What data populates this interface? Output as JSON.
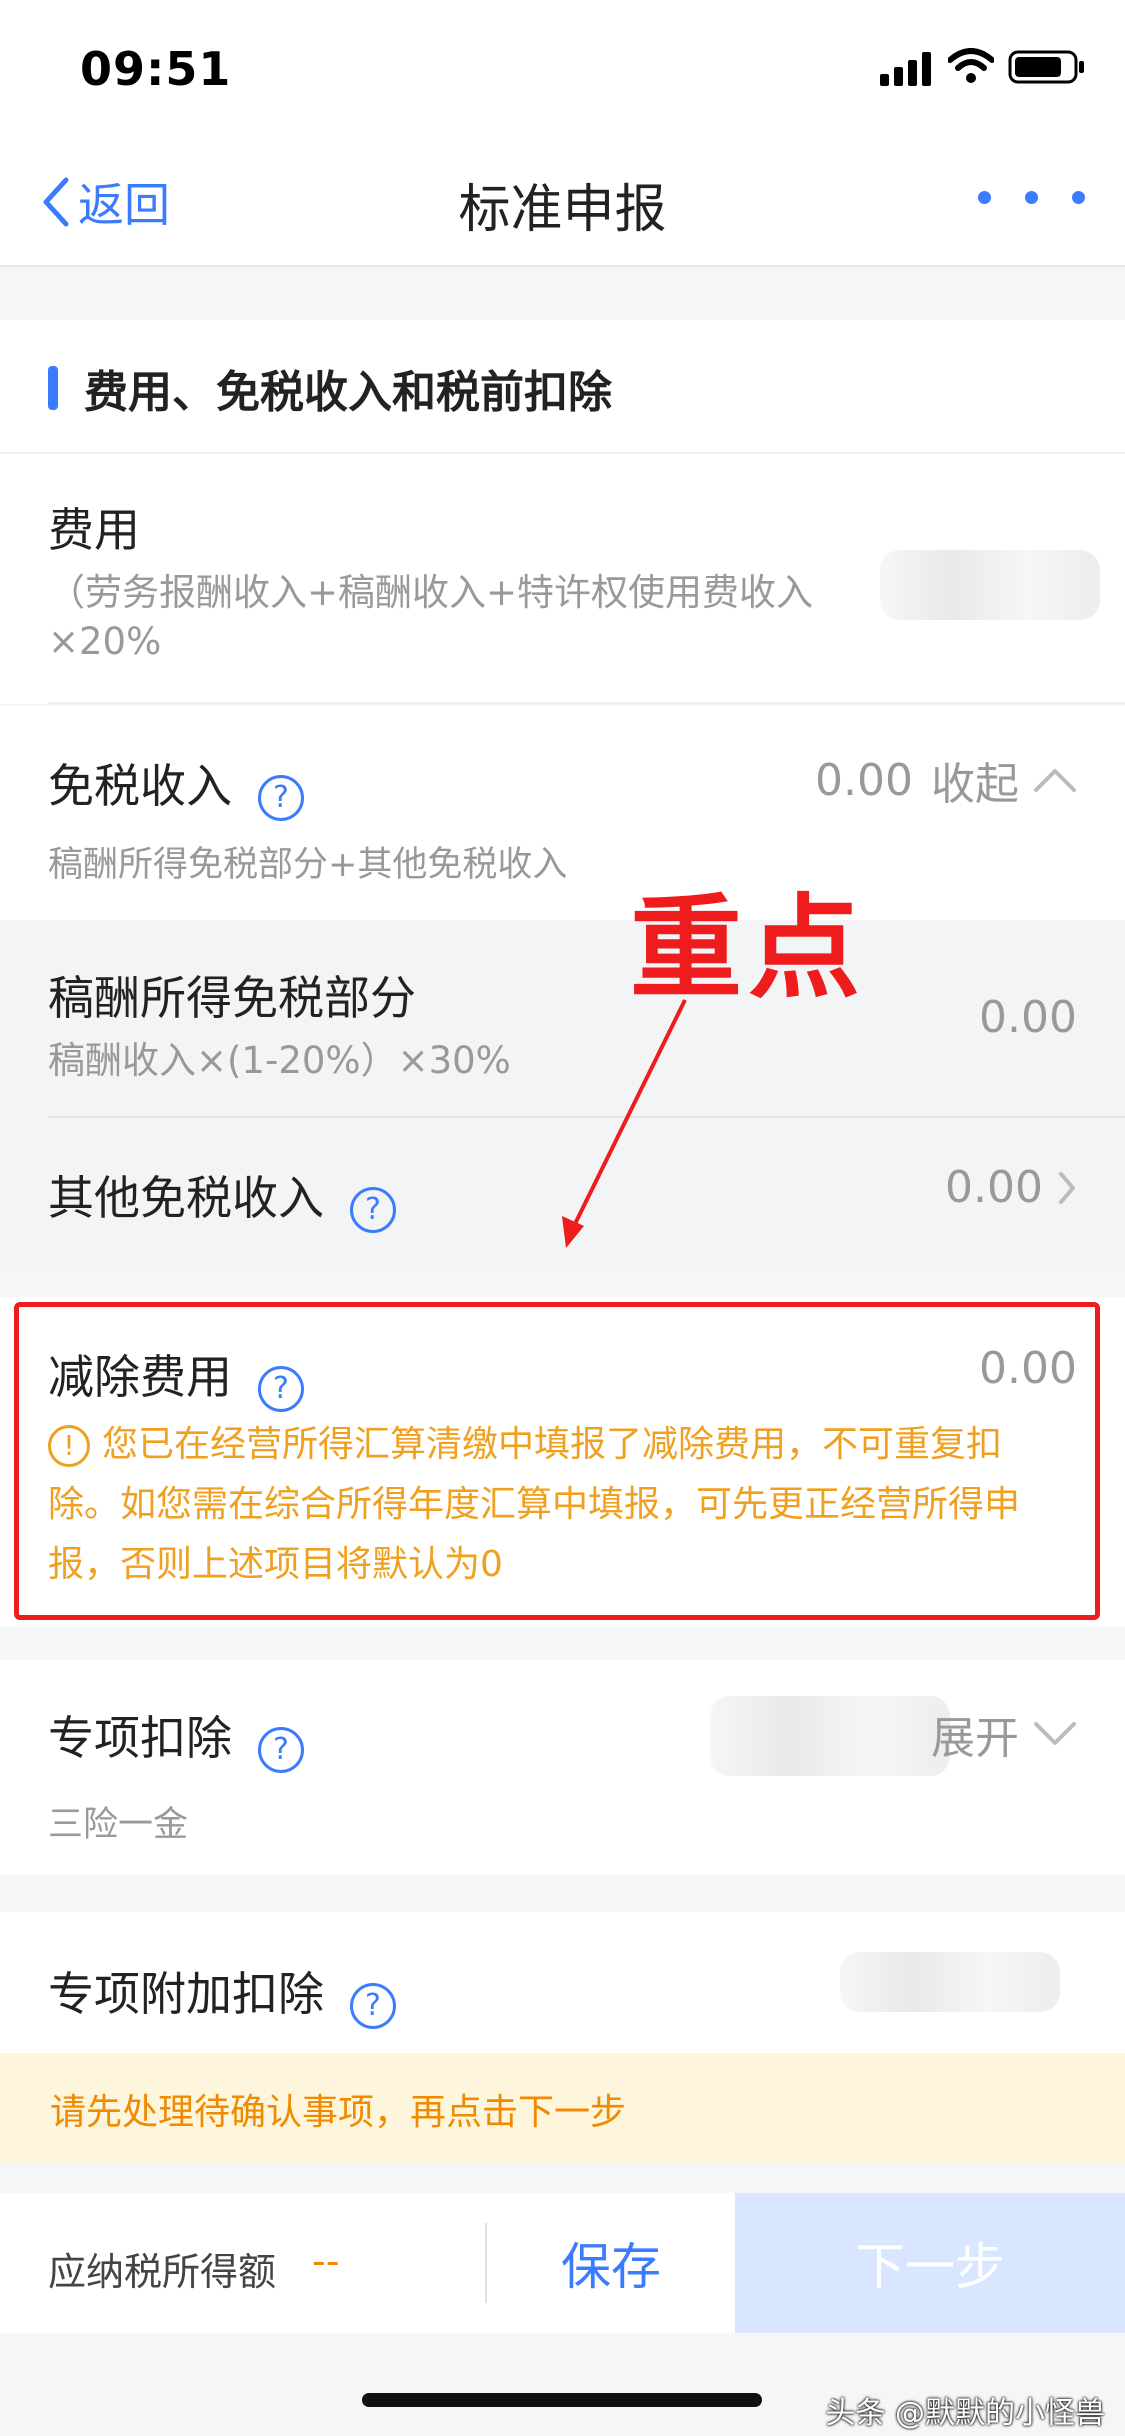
{
  "status_bar": {
    "time": "09:51"
  },
  "nav": {
    "back_label": "返回",
    "title": "标准申报"
  },
  "section": {
    "title": "费用、免税收入和税前扣除"
  },
  "fee": {
    "label": "费用",
    "formula_line1": "（劳务报酬收入+稿酬收入+特许权使用费收入",
    "formula_line2": "×20%"
  },
  "tax_free": {
    "label": "免税收入",
    "value": "0.00",
    "toggle": "收起",
    "desc": "稿酬所得免税部分+其他免税收入"
  },
  "royalty_free": {
    "label": "稿酬所得免税部分",
    "formula": "稿酬收入×(1-20%）×30%",
    "value": "0.00"
  },
  "other_free": {
    "label": "其他免税收入",
    "value": "0.00"
  },
  "annotation": {
    "text": "重点",
    "color": "#ee1c1c"
  },
  "deduction": {
    "label": "减除费用",
    "value": "0.00",
    "warning_line1": "您已在经营所得汇算清缴中填报了减除费用，不可重复扣",
    "warning_line2": "除。如您需在综合所得年度汇算中填报，可先更正经营所得申",
    "warning_line3": "报，否则上述项目将默认为0"
  },
  "special": {
    "label": "专项扣除",
    "toggle_partial": "展开",
    "desc": "三险一金"
  },
  "additional": {
    "label": "专项附加扣除"
  },
  "notice": {
    "text": "请先处理待确认事项，再点击下一步"
  },
  "bottom": {
    "taxable_label": "应纳税所得额",
    "taxable_value": "--",
    "save_label": "保存",
    "next_label": "下一步"
  },
  "watermark": "头条 @默默的小怪兽",
  "colors": {
    "accent": "#3b7cff",
    "warning": "#f0a020",
    "annotation_red": "#ee1c1c"
  }
}
